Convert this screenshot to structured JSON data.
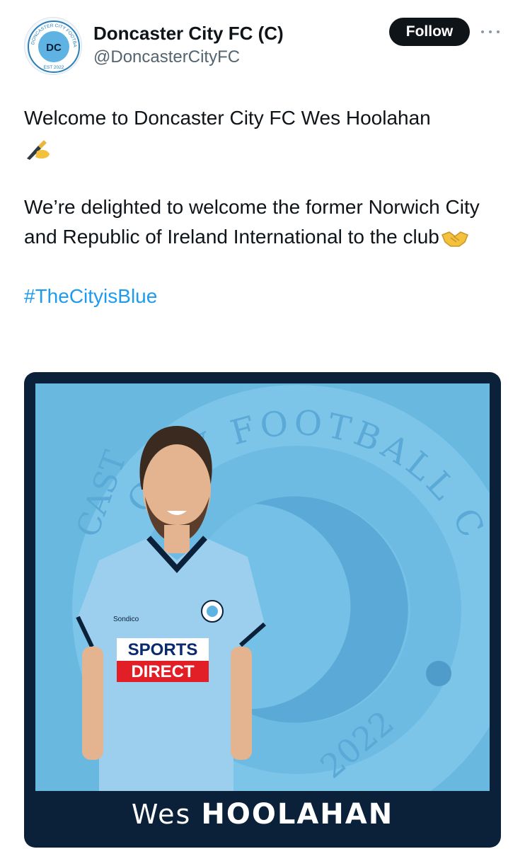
{
  "account": {
    "name": "Doncaster City FC (C)",
    "handle": "@DoncasterCityFC",
    "avatar_badge": {
      "initials": "DC",
      "ring_text": "DONCASTER CITY FOOTBALL CLUB",
      "est": "EST 2022"
    }
  },
  "follow_label": "Follow",
  "more_icon": "more-horizontal-icon",
  "tweet": {
    "line1": "Welcome to Doncaster City FC Wes Hoolahan",
    "emoji1": "writing-hand-emoji",
    "para2": "We’re delighted to welcome the former Norwich City and Republic of Ireland International to the club",
    "emoji2": "handshake-emoji",
    "hashtag": "#TheCityisBlue"
  },
  "media": {
    "crest_text": "CITY FOOTBALL CLUB",
    "crest_left": "CAST",
    "crest_year": "2022",
    "shirt_sponsor_top": "SPORTS",
    "shirt_sponsor_bottom": "DIRECT",
    "kit_brand": "Sondico",
    "caption_first": "Wes",
    "caption_last": "HOOLAHAN",
    "colors": {
      "background": "#69b8e0",
      "frame": "#0b2139",
      "shirt": "#9ccfee"
    }
  }
}
